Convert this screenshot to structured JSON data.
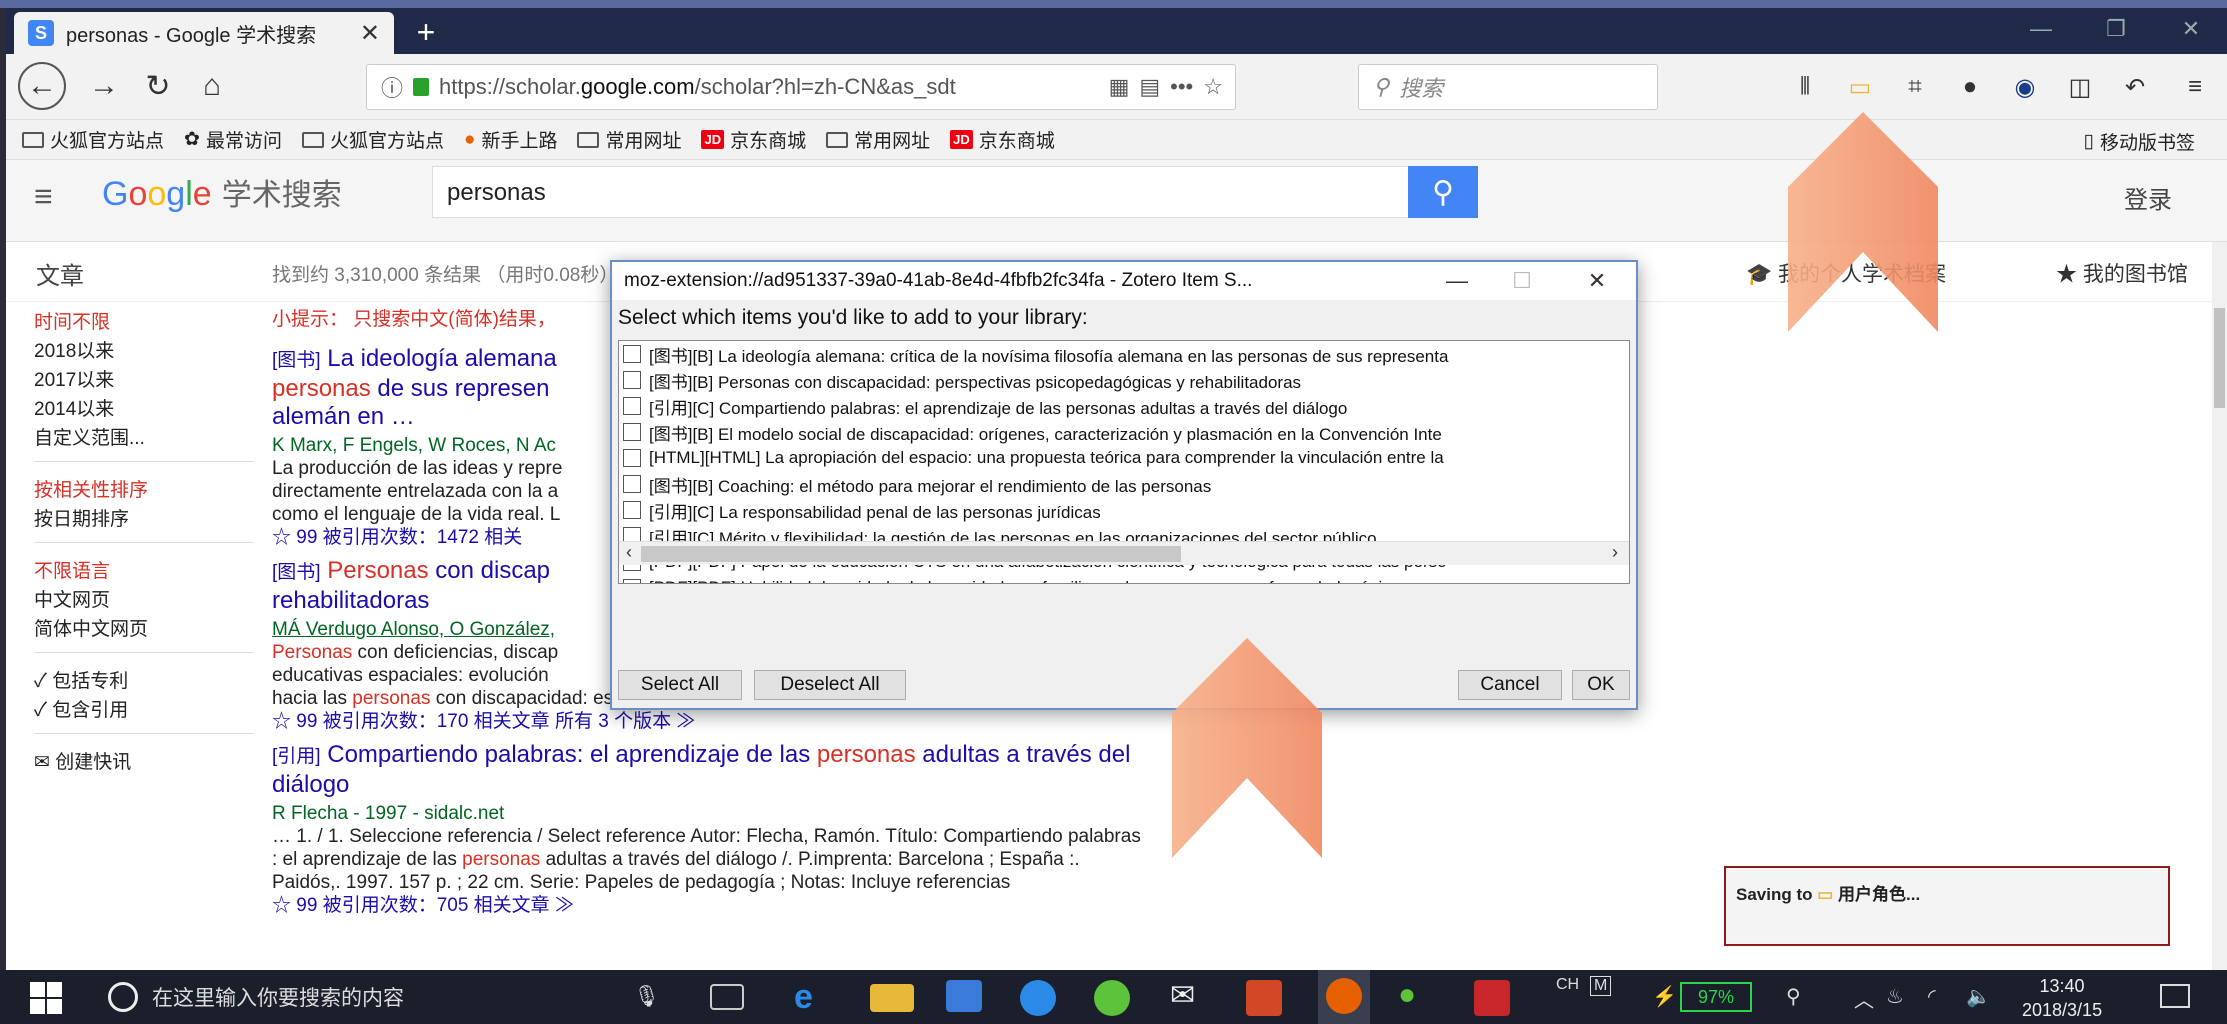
{
  "browser": {
    "tab_title": "personas - Google 学术搜索",
    "url_prefix": "https://scholar.",
    "url_host": "google.com",
    "url_path": "/scholar?hl=zh-CN&as_sdt",
    "search_placeholder": "搜索",
    "bookmarks": [
      {
        "label": "火狐官方站点",
        "icon": "folder-icon"
      },
      {
        "label": "最常访问",
        "icon": "gear-icon"
      },
      {
        "label": "火狐官方站点",
        "icon": "folder-icon"
      },
      {
        "label": "新手上路",
        "icon": "firefox-icon"
      },
      {
        "label": "常用网址",
        "icon": "folder-icon"
      },
      {
        "label": "京东商城",
        "icon": "jd-icon"
      },
      {
        "label": "常用网址",
        "icon": "folder-icon"
      },
      {
        "label": "京东商城",
        "icon": "jd-icon"
      }
    ],
    "mobile_bookmarks": "移动版书签"
  },
  "scholar": {
    "logo_google": "Google",
    "logo_label": "学术搜索",
    "query": "personas",
    "login": "登录",
    "articles_label": "文章",
    "result_stats": "找到约 3,310,000 条结果 （用时0.08秒）",
    "profile_link": "我的个人学术档案",
    "library_link": "我的图书馆",
    "sidebar": {
      "time_any": "时间不限",
      "since_2018": "2018以来",
      "since_2017": "2017以来",
      "since_2014": "2014以来",
      "custom_range": "自定义范围...",
      "sort_relevance": "按相关性排序",
      "sort_date": "按日期排序",
      "lang_any": "不限语言",
      "lang_cn_web": "中文网页",
      "lang_cn_simp": "简体中文网页",
      "include_patents": "包括专利",
      "include_citations": "包含引用",
      "create_alert": "创建快讯"
    },
    "tip": "小提示： 只搜索中文(简体)结果，",
    "results": [
      {
        "type": "[图书]",
        "title_a": "La ideología alemana",
        "title_b": "personas",
        "title_c": " de sus represen",
        "title_d": "alemán en …",
        "authors": "K Marx, F Engels, W Roces, N Ac",
        "snippet1": "La producción de las ideas y repre",
        "snippet2": "directamente entrelazada con la a",
        "snippet3": "como el lenguaje de la vida real. L",
        "links": "☆  99  被引用次数：1472  相关"
      },
      {
        "type": "[图书]",
        "title_a": "Personas",
        "title_b": " con discap",
        "title_c": "rehabilitadoras",
        "authors": "MÁ Verdugo Alonso, O González,",
        "snippet1a": "Personas",
        "snippet1b": " con deficiencias, discap",
        "snippet2": "educativas espaciales: evolución",
        "snippet3a": "hacia las ",
        "snippet3b": "personas",
        "snippet3c": " con discapacidad: estratégias de evaluación e intervención. Las",
        "links": "☆  99  被引用次数：170   相关文章   所有 3 个版本   ≫"
      },
      {
        "type": "[引用]",
        "title_a": "Compartiendo palabras: el aprendizaje de las ",
        "title_b": "personas",
        "title_c": " adultas a través del",
        "title_d": "diálogo",
        "authors": "R Flecha - 1997 - sidalc.net",
        "snippet1": "… 1. / 1. Seleccione referencia / Select reference Autor: Flecha, Ramón. Título: Compartiendo palabras",
        "snippet2a": ": el aprendizaje de las ",
        "snippet2b": "personas",
        "snippet2c": " adultas a través del diálogo /. P.imprenta: Barcelona ; España :.",
        "snippet3": "Paidós,. 1997. 157 p. ; 22 cm. Serie: Papeles de pedagogía ; Notas: Incluye referencias",
        "links": "☆  99  被引用次数：705   相关文章   ≫"
      }
    ]
  },
  "zotero": {
    "title": "moz-extension://ad951337-39a0-41ab-8e4d-4fbfb2fc34fa - Zotero Item S...",
    "prompt": "Select which items you'd like to add to your library:",
    "items": [
      "[图书][B] La ideología alemana: crítica de la novísima filosofía alemana en las personas de sus representa",
      "[图书][B] Personas con discapacidad: perspectivas psicopedagógicas y rehabilitadoras",
      "[引用][C] Compartiendo palabras: el aprendizaje de las personas adultas a través del diálogo",
      "[图书][B] El modelo social de discapacidad: orígenes, caracterización y plasmación en la Convención Inte",
      "[HTML][HTML] La apropiación del espacio: una propuesta teórica para comprender la vinculación entre la",
      "[图书][B] Coaching: el método para mejorar el rendimiento de las personas",
      "[引用][C] La responsabilidad penal de las personas jurídicas",
      "[引用][C] Mérito y flexibilidad: la gestión de las personas en las organizaciones del sector público",
      "[PDF][PDF] Papel de la educación CTS en una alfabetización científica y tecnológica para todas las perso",
      "[PDF][PDF] Habilidad de cuidado de los cuidadores familiares de personas con enfermedad crónica"
    ],
    "select_all": "Select All",
    "deselect_all": "Deselect All",
    "cancel": "Cancel",
    "ok": "OK"
  },
  "saving": {
    "prefix": "Saving to",
    "target": "用户角色..."
  },
  "taskbar": {
    "search_placeholder": "在这里输入你要搜索的内容",
    "battery": "97%",
    "ime": "CH",
    "time": "13:40",
    "date": "2018/3/15"
  },
  "colors": {
    "accent_blue": "#4285f4",
    "link": "#1a0dab",
    "highlight_red": "#d93025",
    "arrow_orange": "#f4a27a"
  }
}
